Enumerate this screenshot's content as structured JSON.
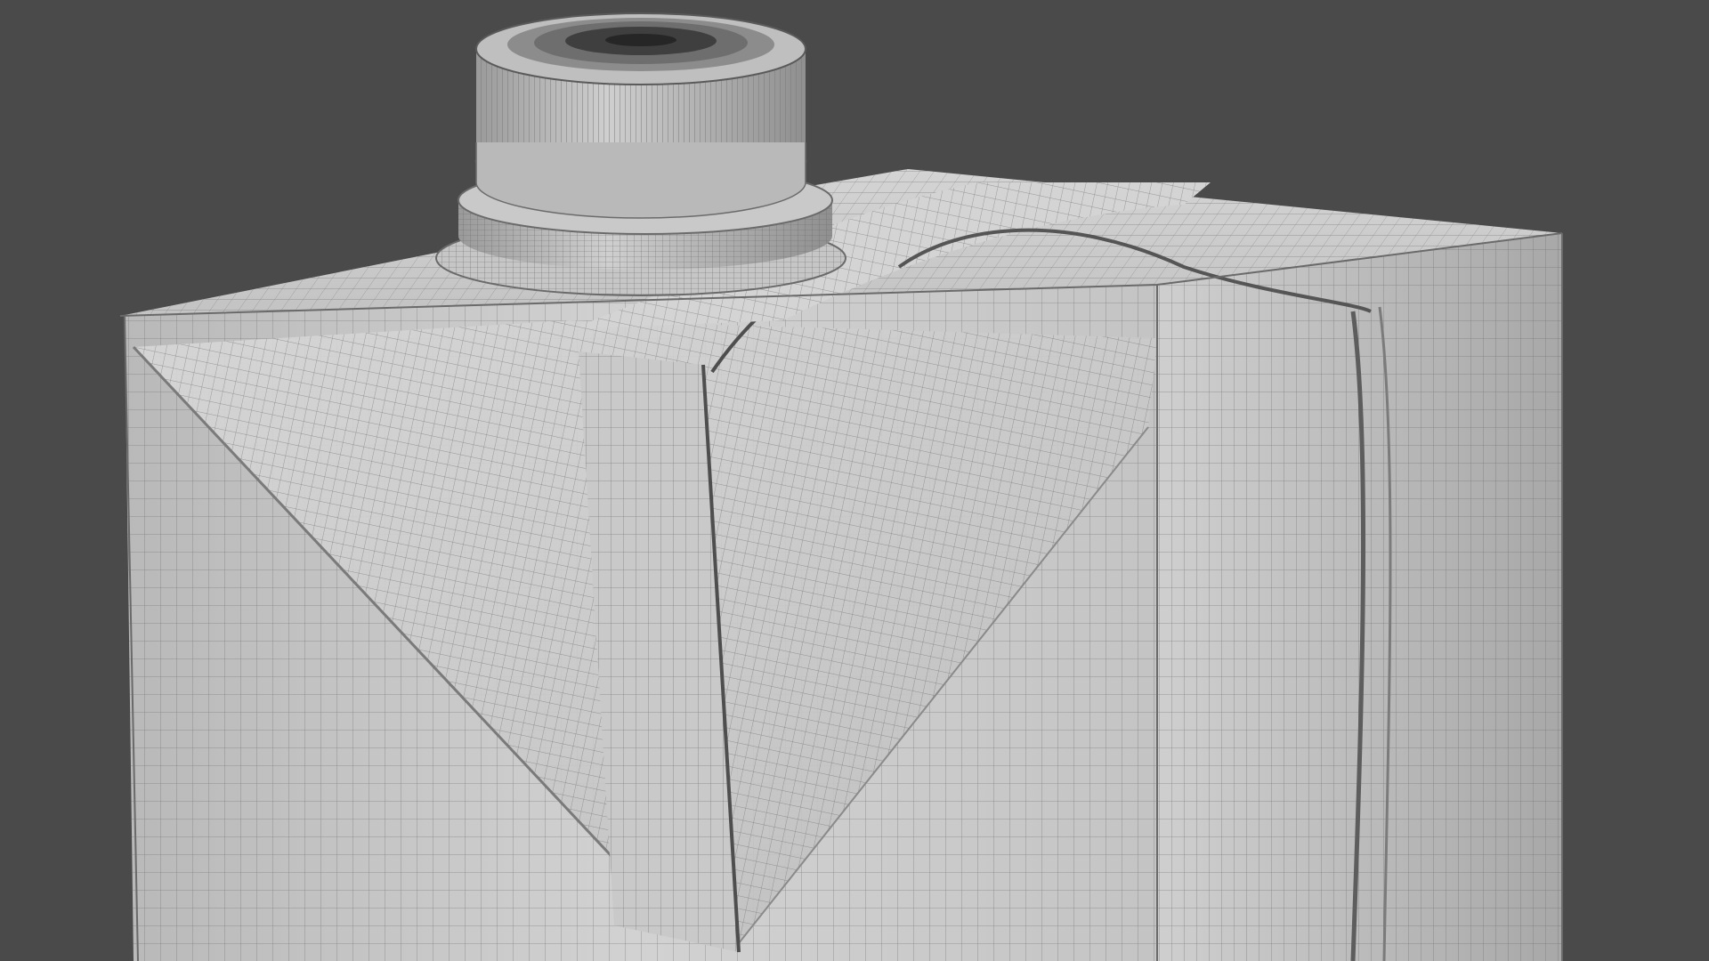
{
  "viewport": {
    "background_color": "#4a4a4a",
    "render_style": "wireframe-on-shaded",
    "subject": "carton-with-screw-cap"
  },
  "model": {
    "body_color": "#c8c8c8",
    "body_light_color": "#d6d6d6",
    "body_dark_color": "#a9a9a9",
    "wire_color": "#5a5a5a",
    "cap_color": "#bdbdbd",
    "cap_dark_color": "#8e8e8e"
  }
}
